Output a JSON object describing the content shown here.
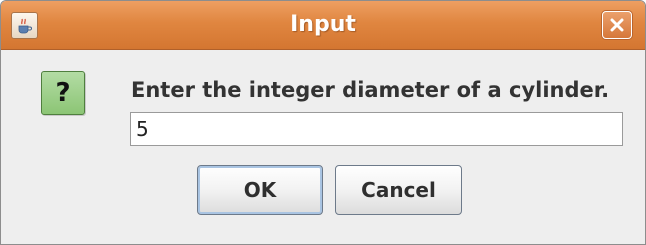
{
  "window": {
    "title": "Input",
    "app_icon": "java-cup-icon",
    "close_icon": "close-icon"
  },
  "dialog": {
    "icon": "question-icon",
    "icon_glyph": "?",
    "message": "Enter the integer diameter of a cylinder.",
    "input_value": "5"
  },
  "buttons": {
    "ok_label": "OK",
    "cancel_label": "Cancel"
  },
  "colors": {
    "titlebar": "#e08640",
    "question_icon": "#8cc575",
    "window_bg": "#eeeeee"
  }
}
